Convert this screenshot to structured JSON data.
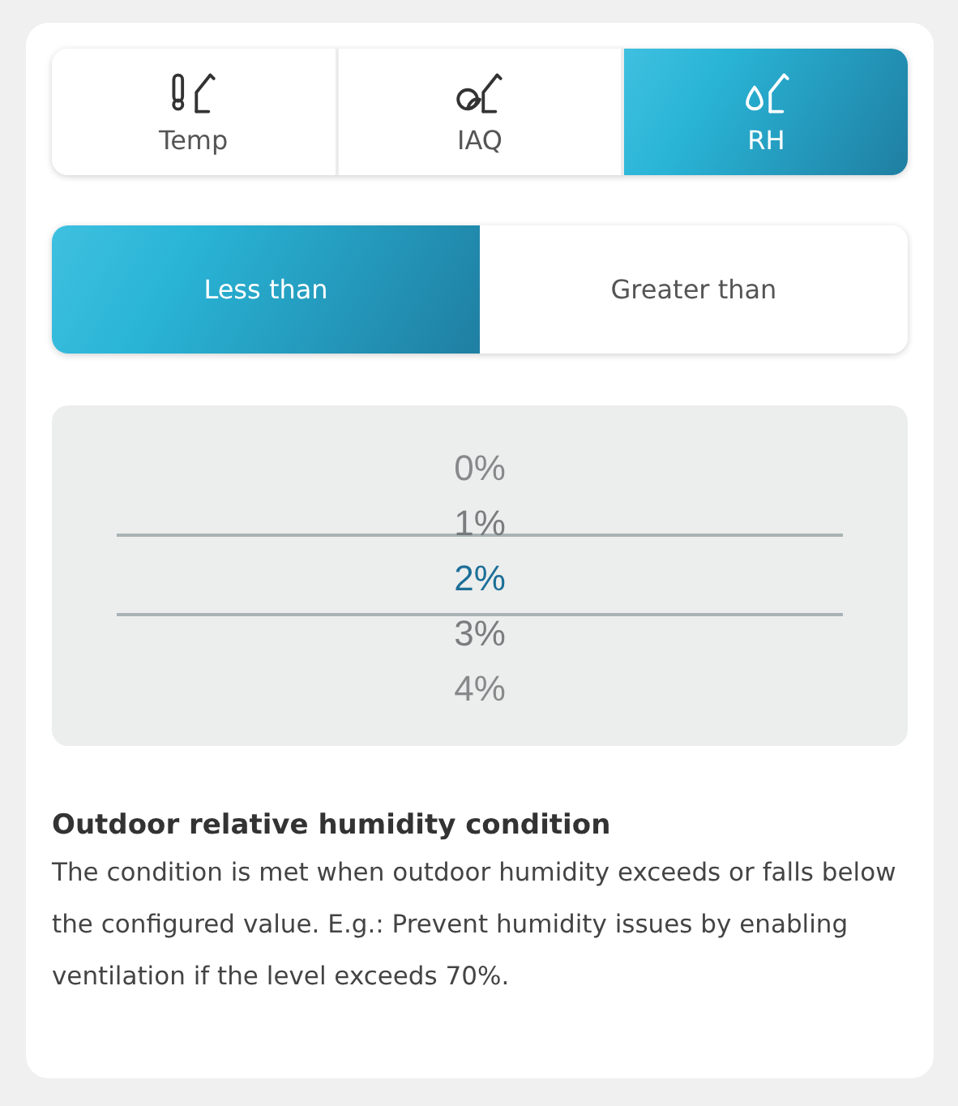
{
  "sensor_tabs": [
    {
      "label": "Temp",
      "kind": "temperature",
      "selected": false
    },
    {
      "label": "IAQ",
      "kind": "air",
      "selected": false
    },
    {
      "label": "RH",
      "kind": "humidity",
      "selected": true
    }
  ],
  "comparison": [
    {
      "label": "Less than",
      "selected": true
    },
    {
      "label": "Greater than",
      "selected": false
    }
  ],
  "picker": {
    "options": [
      {
        "label": "0%",
        "selected": false
      },
      {
        "label": "1%",
        "selected": false
      },
      {
        "label": "2%",
        "selected": true
      },
      {
        "label": "3%",
        "selected": false
      },
      {
        "label": "4%",
        "selected": false
      }
    ]
  },
  "description": {
    "title": "Outdoor relative humidity condition",
    "text": "The condition is met when outdoor humidity exceeds or falls below the configured value. E.g.: Prevent humidity issues by enabling ventilation if the level exceeds 70%."
  }
}
